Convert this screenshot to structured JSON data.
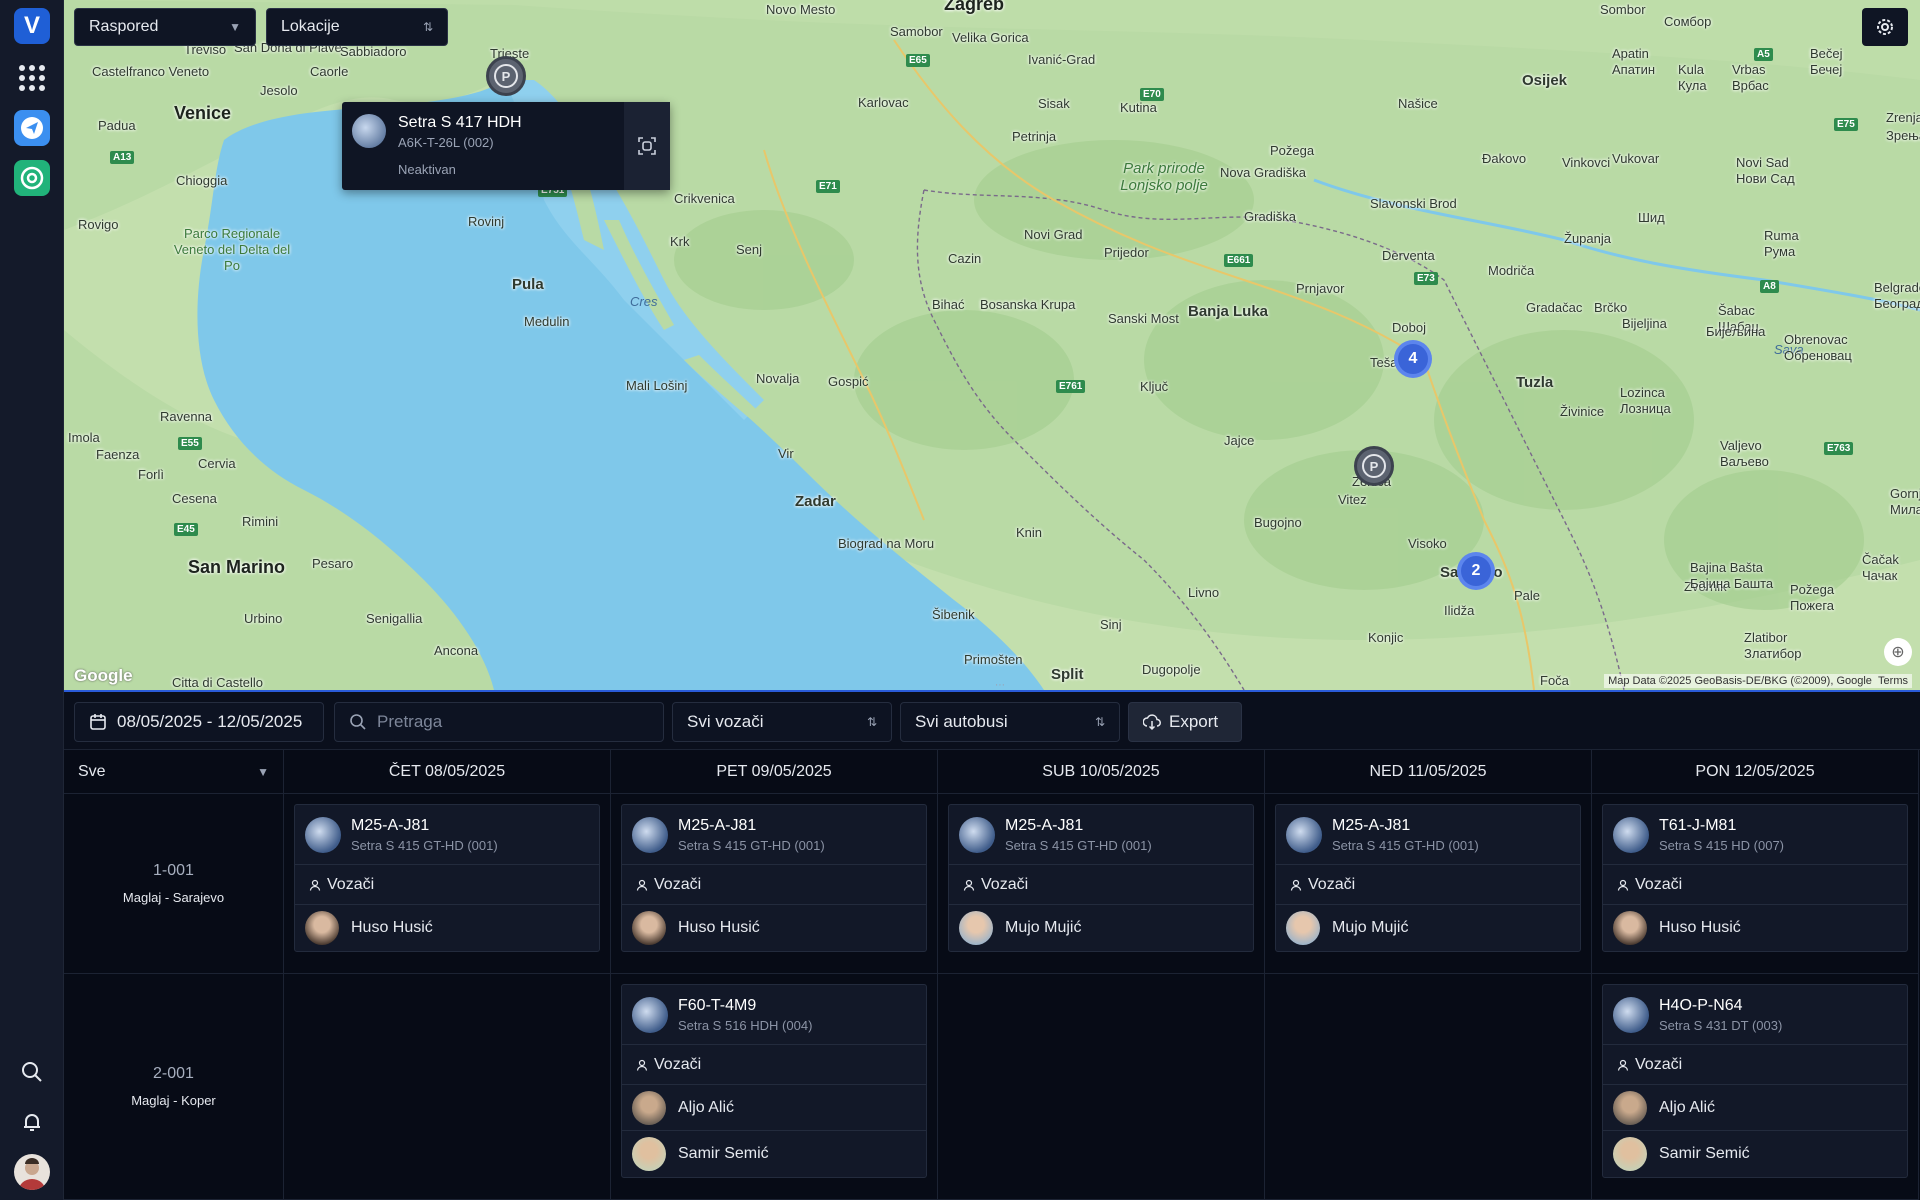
{
  "rail": {
    "logo_letter": "V",
    "icons": [
      "apps-grid-icon",
      "send-icon",
      "location-icon",
      "search-icon",
      "bell-icon",
      "avatar"
    ]
  },
  "map": {
    "selects": {
      "schedule": "Raspored",
      "locations": "Lokacije"
    },
    "labels": {
      "cities_big": [
        "Venice",
        "San Marino",
        "Zagreb"
      ],
      "cities_mid": [
        "Pula",
        "Zadar",
        "Split",
        "Banja Luka",
        "Tuzla",
        "Osijek",
        "Sarajevo"
      ],
      "cities": [
        "Treviso",
        "Padua",
        "Chioggia",
        "Rovigo",
        "Ravenna",
        "Faenza",
        "Forlì",
        "Cesena",
        "Rimini",
        "Pesaro",
        "Urbino",
        "Senigallia",
        "Ancona",
        "Imola",
        "Cervia",
        "Castelfranco Veneto",
        "San Donà di Piave",
        "Jesolo",
        "Caorle",
        "Sabbiadoro",
        "Trieste",
        "Rovinj",
        "Medulin",
        "Krk",
        "Senj",
        "Crikvenica",
        "Cres",
        "Mali Lošinj",
        "Novalja",
        "Gospić",
        "Vir",
        "Biograd na Moru",
        "Šibenik",
        "Primošten",
        "Karlovac",
        "Sisak",
        "Kutina",
        "Petrinja",
        "Novo Mesto",
        "Samobor",
        "Velika Gorica",
        "Ivanić-Grad",
        "Novi Grad",
        "Prijedor",
        "Cazin",
        "Bihać",
        "Bosanska Krupa",
        "Sanski Most",
        "Ključ",
        "Jajce",
        "Bugojno",
        "Vitez",
        "Zenica",
        "Visoko",
        "Ilidža",
        "Pale",
        "Konjic",
        "Livno",
        "Knin",
        "Sinj",
        "Dugopolje",
        "Derventa",
        "Prnjavor",
        "Doboj",
        "Tešanj",
        "Gradačac",
        "Brčko",
        "Bijeljina",
        "Živinice",
        "Zvornik",
        "Gradiška",
        "Nova Gradiška",
        "Slavonski Brod",
        "Požega",
        "Našice",
        "Đakovo",
        "Vinkovci",
        "Vukovar",
        "Županja",
        "Modriča",
        "Novi Sad",
        "Šabac",
        "Valjevo",
        "Lozinca",
        "Ruma",
        "Sombor",
        "Apatin",
        "Kula",
        "Vrbas",
        "Bečej",
        "Zrenjanin",
        "Obrenovac",
        "Belgrade",
        "Bajina Bašta",
        "Čačak",
        "Požega",
        "Zlatibor",
        "Gornji Milanovac",
        "Foča",
        "Citta di Castello"
      ],
      "parks": [
        "Parco Regionale Veneto del Delta del Po",
        "Park prirode Lonjsko polje"
      ],
      "water": [
        "Sava"
      ],
      "cyrillic": [
        "Сомбор",
        "Апатин",
        "Кула",
        "Врбас",
        "Бечеј",
        "Зрењанин",
        "Нови Сад",
        "Шид",
        "Рума",
        "Шабац",
        "Београд",
        "Обреновац",
        "Ваљево",
        "Лозница",
        "Бајина Башта",
        "Чачак",
        "Пожега",
        "Златибор",
        "Милановац",
        "Бијељина"
      ]
    },
    "roads": [
      "E65",
      "E70",
      "E71",
      "E751",
      "E661",
      "E73",
      "E761",
      "E763",
      "E75",
      "A5",
      "A8",
      "A13",
      "E45",
      "E55"
    ],
    "popup": {
      "title": "Setra S 417 HDH",
      "subtitle": "A6K-T-26L (002)",
      "status": "Neaktivan"
    },
    "markers": {
      "parking_letter": "P",
      "cluster_a": "4",
      "cluster_b": "2"
    },
    "google_logo": "Google",
    "attribution": "Map Data ©2025 GeoBasis-DE/BKG (©2009), Google",
    "terms": "Terms"
  },
  "toolbar": {
    "date_range": "08/05/2025 - 12/05/2025",
    "search_placeholder": "Pretraga",
    "drivers_filter": "Svi vozači",
    "buses_filter": "Svi autobusi",
    "export_label": "Export"
  },
  "schedule": {
    "first_header": "Sve",
    "days": [
      "ČET 08/05/2025",
      "PET 09/05/2025",
      "SUB 10/05/2025",
      "NED 11/05/2025",
      "PON 12/05/2025"
    ],
    "drivers_label": "Vozači",
    "rows": [
      {
        "num": "1-001",
        "route": "Maglaj - Sarajevo",
        "cells": [
          {
            "plate": "M25-A-J81",
            "model": "Setra S 415 GT-HD (001)",
            "drivers": [
              "Huso Husić"
            ]
          },
          {
            "plate": "M25-A-J81",
            "model": "Setra S 415 GT-HD (001)",
            "drivers": [
              "Huso Husić"
            ]
          },
          {
            "plate": "M25-A-J81",
            "model": "Setra S 415 GT-HD (001)",
            "drivers": [
              "Mujo Mujić"
            ]
          },
          {
            "plate": "M25-A-J81",
            "model": "Setra S 415 GT-HD (001)",
            "drivers": [
              "Mujo Mujić"
            ]
          },
          {
            "plate": "T61-J-M81",
            "model": "Setra S 415 HD (007)",
            "drivers": [
              "Huso Husić"
            ]
          }
        ]
      },
      {
        "num": "2-001",
        "route": "Maglaj - Koper",
        "cells": [
          null,
          {
            "plate": "F60-T-4M9",
            "model": "Setra S 516 HDH (004)",
            "drivers": [
              "Aljo Alić",
              "Samir Semić"
            ]
          },
          null,
          null,
          {
            "plate": "H4O-P-N64",
            "model": "Setra S 431 DT (003)",
            "drivers": [
              "Aljo Alić",
              "Samir Semić"
            ]
          }
        ]
      }
    ]
  }
}
